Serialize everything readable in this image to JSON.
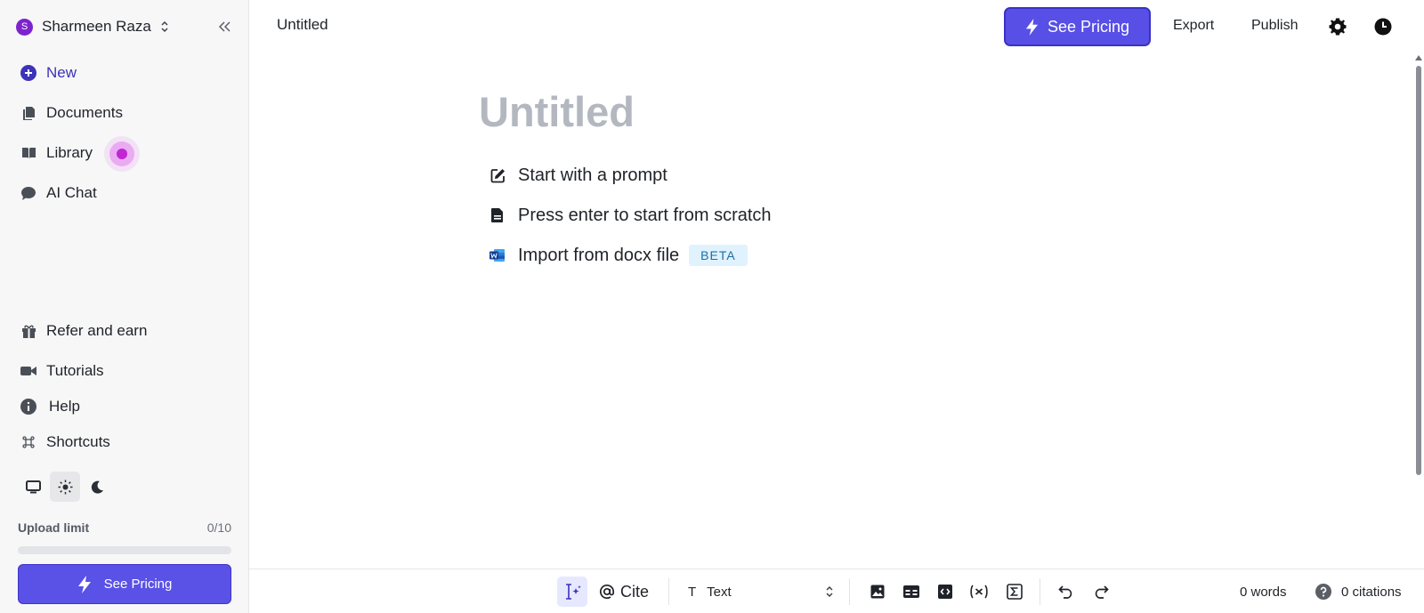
{
  "sidebar": {
    "user": {
      "initial": "S",
      "name": "Sharmeen Raza"
    },
    "nav": [
      {
        "label": "New"
      },
      {
        "label": "Documents"
      },
      {
        "label": "Library"
      },
      {
        "label": "AI Chat"
      }
    ],
    "bottom_nav": [
      {
        "label": "Refer and earn"
      },
      {
        "label": "Tutorials"
      },
      {
        "label": "Help"
      },
      {
        "label": "Shortcuts"
      }
    ],
    "upload": {
      "label": "Upload limit",
      "count": "0/10",
      "progress": 0
    },
    "pricing_label": "See Pricing"
  },
  "header": {
    "doc_title": "Untitled",
    "pricing_label": "See Pricing",
    "export_label": "Export",
    "publish_label": "Publish"
  },
  "editor": {
    "title_placeholder": "Untitled",
    "options": [
      {
        "label": "Start with a prompt"
      },
      {
        "label": "Press enter to start from scratch"
      },
      {
        "label": "Import from docx file",
        "badge": "BETA"
      }
    ]
  },
  "toolbar": {
    "cite_label": "Cite",
    "text_style_label": "T",
    "text_style_value": "Text",
    "words": "0 words",
    "citations": "0 citations"
  },
  "colors": {
    "accent": "#574fe6",
    "avatar": "#7e22ce",
    "badge_bg": "#e0f2fe"
  }
}
